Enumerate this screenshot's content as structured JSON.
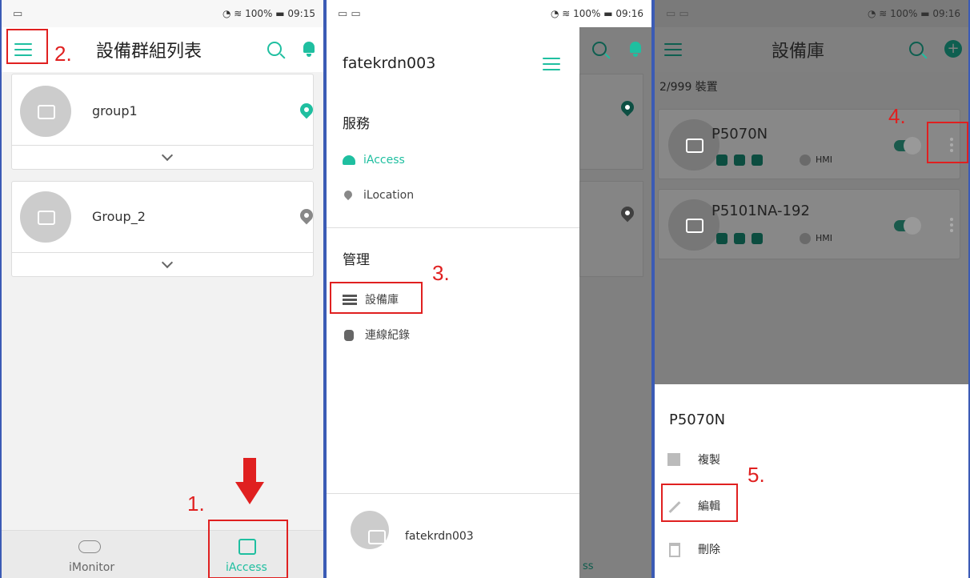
{
  "panel1": {
    "status": {
      "left_icon": "▭",
      "battery": "100%",
      "time": "09:15"
    },
    "title": "設備群組列表",
    "groups": [
      {
        "name": "group1",
        "pin_color": "#1fbfa0"
      },
      {
        "name": "Group_2",
        "pin_color": "#888888"
      }
    ],
    "nav": {
      "imonitor": "iMonitor",
      "iaccess": "iAccess"
    },
    "steps": {
      "s1": "1.",
      "s2": "2."
    }
  },
  "panel2": {
    "status": {
      "left_icon": "▭ ▭",
      "battery": "100%",
      "time": "09:16"
    },
    "username": "fatekrdn003",
    "section_service": "服務",
    "service_items": [
      "iAccess",
      "iLocation"
    ],
    "section_manage": "管理",
    "manage_items": [
      "設備庫",
      "連線紀錄"
    ],
    "footer_user": "fatekrdn003",
    "step": "3.",
    "behind_text": "ss"
  },
  "panel3": {
    "status": {
      "left_icon": "▭ ▭",
      "battery": "100%",
      "time": "09:16"
    },
    "title": "設備庫",
    "count": "2/999  裝置",
    "devices": [
      {
        "name": "P5070N",
        "tag": "HMI"
      },
      {
        "name": "P5101NA-192",
        "tag": "HMI"
      }
    ],
    "sheet_title": "P5070N",
    "sheet_items": [
      "複製",
      "編輯",
      "刪除"
    ],
    "steps": {
      "s4": "4.",
      "s5": "5."
    }
  }
}
